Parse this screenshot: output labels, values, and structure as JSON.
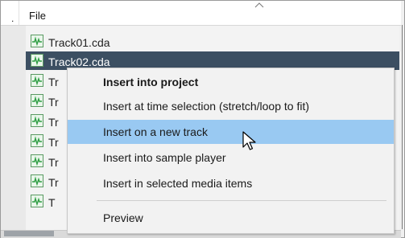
{
  "header": {
    "left_glyph": ".",
    "column_label": "File"
  },
  "file_list": {
    "icon": "audio-track-icon",
    "rows": [
      {
        "label": "Track01.cda",
        "selected": false
      },
      {
        "label": "Track02.cda",
        "selected": true
      },
      {
        "label": "Tr",
        "selected": false
      },
      {
        "label": "Tr",
        "selected": false
      },
      {
        "label": "Tr",
        "selected": false
      },
      {
        "label": "Tr",
        "selected": false
      },
      {
        "label": "Tr",
        "selected": false
      },
      {
        "label": "Tr",
        "selected": false
      },
      {
        "label": "T",
        "selected": false
      }
    ]
  },
  "context_menu": {
    "items": [
      {
        "label": "Insert into project",
        "bold": true
      },
      {
        "label": "Insert at time selection (stretch/loop to fit)"
      },
      {
        "label": "Insert on a new track",
        "highlighted": true
      },
      {
        "label": "Insert into sample player"
      },
      {
        "label": "Insert in selected media items"
      },
      {
        "label": "Preview"
      }
    ]
  },
  "colors": {
    "selection": "#3c4f62",
    "menu_highlight": "#99c9f2",
    "icon_green": "#3aa84a"
  }
}
